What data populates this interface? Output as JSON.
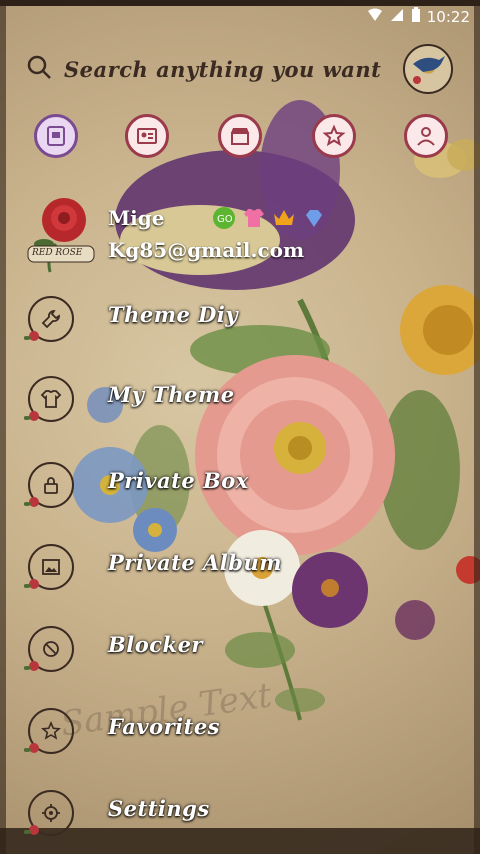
{
  "status_bar": {
    "time": "10:22"
  },
  "search": {
    "placeholder": "Search anything you want"
  },
  "quick_actions": [
    {
      "icon": "sms-icon"
    },
    {
      "icon": "contact-card-icon"
    },
    {
      "icon": "store-icon"
    },
    {
      "icon": "star-icon"
    },
    {
      "icon": "person-icon"
    }
  ],
  "profile": {
    "name": "Mige",
    "email": "Kg85@gmail.com",
    "rose_label": "RED ROSE",
    "badges": [
      "go-icon",
      "shirt-icon",
      "crown-icon",
      "diamond-icon"
    ]
  },
  "menu": [
    {
      "label": "Theme Diy",
      "icon": "wrench-icon"
    },
    {
      "label": "My Theme",
      "icon": "shirt-icon"
    },
    {
      "label": "Private Box",
      "icon": "lock-icon"
    },
    {
      "label": "Private Album",
      "icon": "image-icon"
    },
    {
      "label": "Blocker",
      "icon": "block-icon"
    },
    {
      "label": "Favorites",
      "icon": "star-icon"
    },
    {
      "label": "Settings",
      "icon": "gear-icon"
    }
  ],
  "watermark": "Sample Text",
  "colors": {
    "accent": "#9b3a4a",
    "accent_purple": "#7a4a93",
    "paper": "#c9b694",
    "ink": "#3a2a22"
  }
}
